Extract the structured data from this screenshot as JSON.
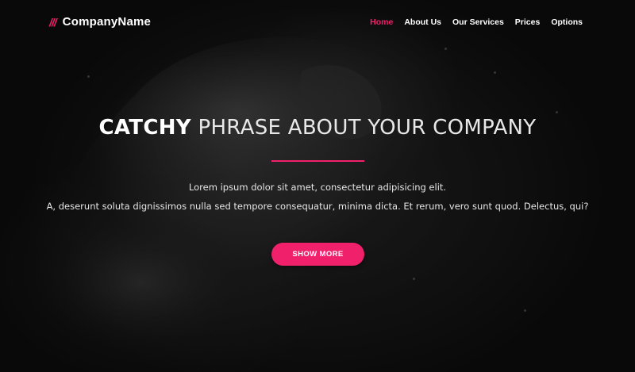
{
  "brand": {
    "slashes": "///",
    "name": "CompanyName"
  },
  "nav": {
    "items": [
      {
        "label": "Home",
        "active": true
      },
      {
        "label": "About Us",
        "active": false
      },
      {
        "label": "Our Services",
        "active": false
      },
      {
        "label": "Prices",
        "active": false
      },
      {
        "label": "Options",
        "active": false
      }
    ]
  },
  "hero": {
    "headline_strong": "CATCHY",
    "headline_rest": "PHRASE ABOUT YOUR COMPANY",
    "lead_line1": "Lorem ipsum dolor sit amet, consectetur adipisicing elit.",
    "lead_line2": "A, deserunt soluta dignissimos nulla sed tempore consequatur, minima dicta. Et rerum, vero sunt quod. Delectus, qui?",
    "cta_label": "SHOW MORE"
  },
  "colors": {
    "accent": "#f0206a",
    "background": "#1a1a1a",
    "text": "#ffffff"
  }
}
